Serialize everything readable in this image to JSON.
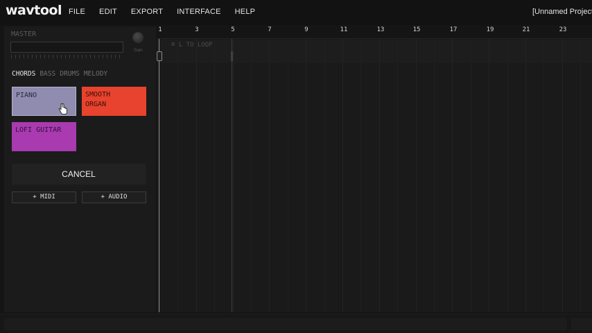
{
  "app": {
    "logo": "wavtool",
    "project_title": "[Unnamed Project"
  },
  "menu": [
    "FILE",
    "EDIT",
    "EXPORT",
    "INTERFACE",
    "HELP"
  ],
  "master": {
    "label": "MASTER",
    "gain_label": "Gain"
  },
  "tabs": {
    "chords": "CHORDS",
    "bass": "BASS",
    "drums": "DRUMS",
    "melody": "MELODY",
    "active": "CHORDS"
  },
  "presets": {
    "piano": "PIANO",
    "organ_line1": "SMOOTH",
    "organ_line2": "ORGAN",
    "guitar": "LOFI GUITAR"
  },
  "buttons": {
    "cancel": "CANCEL",
    "add_midi": "+ MIDI",
    "add_audio": "+ AUDIO"
  },
  "timeline": {
    "bars": [
      "1",
      "3",
      "5",
      "7",
      "9",
      "11",
      "13",
      "15",
      "17",
      "19",
      "21",
      "23"
    ],
    "loop_hint": "⌘ L TO LOOP"
  },
  "colors": {
    "piano": "#8f8cb0",
    "organ": "#e8432e",
    "guitar": "#a93ab0",
    "background": "#141414"
  },
  "icons": {
    "cursor": "hand-pointer-icon",
    "gain": "knob-icon"
  }
}
